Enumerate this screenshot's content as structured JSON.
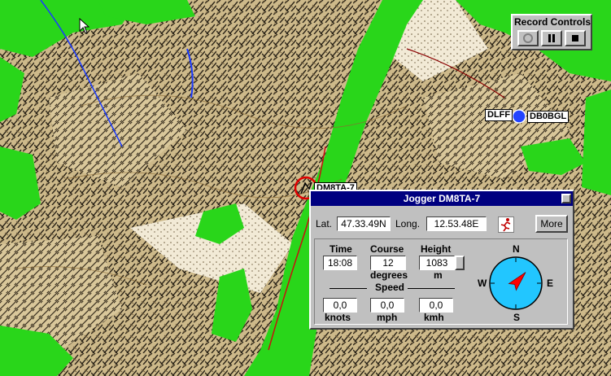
{
  "map": {
    "callsigns": [
      "DLFF",
      "DB0BGL"
    ],
    "tracked_label": "DM8TA-7"
  },
  "record_controls": {
    "title": "Record Controls",
    "buttons": [
      "record-icon",
      "pause-icon",
      "stop-icon"
    ]
  },
  "tracker": {
    "title": "Jogger  DM8TA-7",
    "lat_label": "Lat.",
    "lat_value": "47.33.49N",
    "long_label": "Long.",
    "long_value": "12.53.48E",
    "more_label": "More",
    "time_label": "Time",
    "time_value": "18:08",
    "course_label": "Course",
    "course_value": "12",
    "course_unit": "degrees",
    "height_label": "Height",
    "height_value": "1083",
    "height_unit": "m",
    "speed_label": "Speed",
    "speeds": [
      {
        "value": "0,0",
        "unit": "knots"
      },
      {
        "value": "0,0",
        "unit": "mph"
      },
      {
        "value": "0,0",
        "unit": "kmh"
      }
    ],
    "compass": {
      "n": "N",
      "s": "S",
      "e": "E",
      "w": "W",
      "heading_deg": 12
    }
  },
  "colors": {
    "forest": "#29d61a",
    "title_bar": "#000080",
    "compass_face": "#22c6ff",
    "needle": "#ff0000",
    "target_ring": "#e00000"
  }
}
